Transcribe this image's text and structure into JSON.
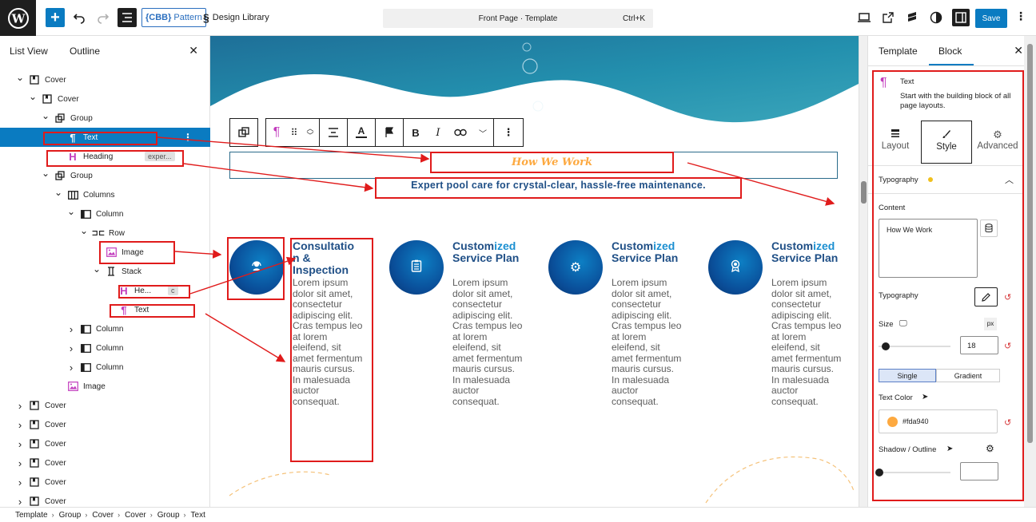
{
  "topbar": {
    "pattern_badge": "{CBB}",
    "pattern_label": "Pattern",
    "design_library": "Design Library",
    "document_title": "Front Page · Template",
    "shortcut": "Ctrl+K",
    "save": "Save"
  },
  "list_view": {
    "tab_list": "List View",
    "tab_outline": "Outline",
    "rows": [
      {
        "label": "Cover",
        "badge": ""
      },
      {
        "label": "Cover",
        "badge": ""
      },
      {
        "label": "Group",
        "badge": ""
      },
      {
        "label": "Text",
        "badge": ""
      },
      {
        "label": "Heading",
        "badge": "exper..."
      },
      {
        "label": "Group",
        "badge": ""
      },
      {
        "label": "Columns",
        "badge": ""
      },
      {
        "label": "Column",
        "badge": ""
      },
      {
        "label": "Row",
        "badge": ""
      },
      {
        "label": "Image",
        "badge": ""
      },
      {
        "label": "Stack",
        "badge": ""
      },
      {
        "label": "He...",
        "badge": "c"
      },
      {
        "label": "Text",
        "badge": ""
      },
      {
        "label": "Column",
        "badge": ""
      },
      {
        "label": "Column",
        "badge": ""
      },
      {
        "label": "Column",
        "badge": ""
      },
      {
        "label": "Image",
        "badge": ""
      },
      {
        "label": "Cover",
        "badge": ""
      },
      {
        "label": "Cover",
        "badge": ""
      },
      {
        "label": "Cover",
        "badge": ""
      },
      {
        "label": "Cover",
        "badge": ""
      },
      {
        "label": "Cover",
        "badge": ""
      },
      {
        "label": "Cover",
        "badge": ""
      }
    ]
  },
  "canvas": {
    "section_label": "How We Work",
    "subtitle": "Expert pool care for crystal-clear, hassle-free maintenance.",
    "services": [
      {
        "title_dark": "Consultatio",
        "title_light": "",
        "title_rest": "n & Inspection",
        "text": "Lorem ipsum dolor sit amet, consectetur adipiscing elit. Cras tempus leo at lorem eleifend, sit amet fermentum mauris cursus. In malesuada auctor consequat."
      },
      {
        "title_dark": "Custom",
        "title_light": "ized",
        "title_rest": "Service Plan",
        "text": "Lorem ipsum dolor sit amet, consectetur adipiscing elit. Cras tempus leo at lorem eleifend, sit amet fermentum mauris cursus. In malesuada auctor consequat."
      },
      {
        "title_dark": "Custom",
        "title_light": "ized",
        "title_rest": "Service Plan",
        "text": "Lorem ipsum dolor sit amet, consectetur adipiscing elit. Cras tempus leo at lorem eleifend, sit amet fermentum mauris cursus. In malesuada auctor consequat."
      },
      {
        "title_dark": "Custom",
        "title_light": "ized",
        "title_rest": "Service Plan",
        "text": "Lorem ipsum dolor sit amet, consectetur adipiscing elit. Cras tempus leo at lorem eleifend, sit amet fermentum mauris cursus. In malesuada auctor consequat."
      }
    ]
  },
  "inspector": {
    "tab_template": "Template",
    "tab_block": "Block",
    "block_name": "Text",
    "block_desc": "Start with the building block of all page layouts.",
    "tab_layout": "Layout",
    "tab_style": "Style",
    "tab_advanced": "Advanced",
    "typography_section": "Typography",
    "content_label": "Content",
    "content_value": "How We Work",
    "typography_label": "Typography",
    "size_label": "Size",
    "size_unit": "px",
    "size_value": "18",
    "size_fraction": 0.1,
    "mode_single": "Single",
    "mode_gradient": "Gradient",
    "text_color_label": "Text Color",
    "text_color_value": "#fda940",
    "shadow_label": "Shadow / Outline"
  },
  "breadcrumb": [
    "Template",
    "Group",
    "Cover",
    "Cover",
    "Group",
    "Text"
  ],
  "colors": {
    "accent": "#0a7bc1",
    "highlight": "#fda940",
    "annotation": "#e01b1b"
  }
}
